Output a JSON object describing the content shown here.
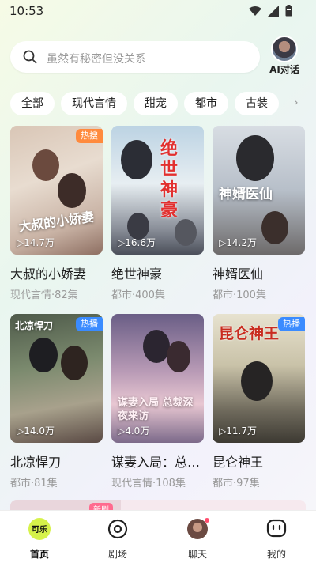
{
  "status": {
    "time": "10:53"
  },
  "search": {
    "placeholder": "虽然有秘密但没关系"
  },
  "ai": {
    "label": "AI对话"
  },
  "categories": [
    "全部",
    "现代言情",
    "甜宠",
    "都市",
    "古装"
  ],
  "cards": [
    {
      "title": "大叔的小娇妻",
      "sub": "现代言情·82集",
      "plays": "14.7万",
      "badge": "热搜",
      "badge_color": "#ff8a3d",
      "art": "大叔的小娇妻"
    },
    {
      "title": "绝世神豪",
      "sub": "都市·400集",
      "plays": "16.6万",
      "badge": "",
      "art": "绝世神豪"
    },
    {
      "title": "神婿医仙",
      "sub": "都市·100集",
      "plays": "14.2万",
      "badge": "",
      "art": "神婿医仙"
    },
    {
      "title": "北凉悍刀",
      "sub": "都市·81集",
      "plays": "14.0万",
      "badge": "热播",
      "badge_color": "#3a8bff",
      "art": "北凉悍刀"
    },
    {
      "title": "谋妻入局：总…",
      "sub": "现代言情·108集",
      "plays": "4.0万",
      "badge": "",
      "art": "谋妻入局 总裁深夜来访"
    },
    {
      "title": "昆仑神王",
      "sub": "都市·97集",
      "plays": "11.7万",
      "badge": "热播",
      "badge_color": "#3a8bff",
      "art": "昆仑神王"
    }
  ],
  "peek": {
    "tag": "新剧"
  },
  "tabs": [
    {
      "label": "首页",
      "icon": "home-logo-icon",
      "active": true
    },
    {
      "label": "剧场",
      "icon": "theater-icon",
      "active": false
    },
    {
      "label": "聊天",
      "icon": "chat-avatar-icon",
      "active": false
    },
    {
      "label": "我的",
      "icon": "profile-icon",
      "active": false
    }
  ]
}
